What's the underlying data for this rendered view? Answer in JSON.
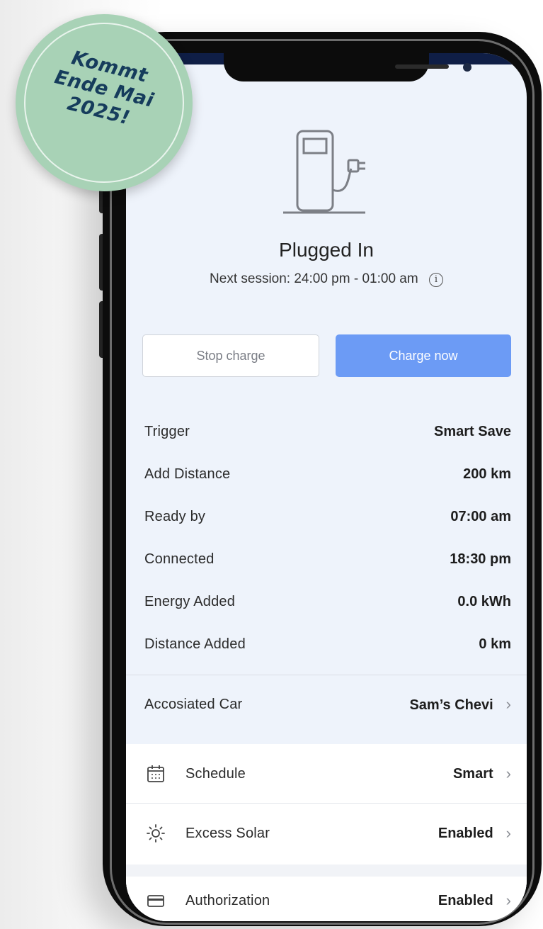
{
  "badge": {
    "lines": [
      "Kommt",
      "Ende Mai",
      "2025!"
    ]
  },
  "status": {
    "title": "Plugged In",
    "next_session": "Next session: 24:00 pm - 01:00 am",
    "info_glyph": "i"
  },
  "buttons": {
    "stop": "Stop charge",
    "charge": "Charge now"
  },
  "details": [
    {
      "label": "Trigger",
      "value": "Smart Save"
    },
    {
      "label": "Add Distance",
      "value": "200 km"
    },
    {
      "label": "Ready by",
      "value": "07:00 am"
    },
    {
      "label": "Connected",
      "value": "18:30 pm"
    },
    {
      "label": "Energy Added",
      "value": "0.0 kWh"
    },
    {
      "label": "Distance Added",
      "value": "0 km"
    }
  ],
  "associated_car": {
    "label": "Accosiated Car",
    "value": "Sam’s Chevi"
  },
  "settings": [
    {
      "icon": "calendar-icon",
      "label": "Schedule",
      "value": "Smart"
    },
    {
      "icon": "sun-icon",
      "label": "Excess Solar",
      "value": "Enabled"
    },
    {
      "icon": "card-icon",
      "label": "Authorization",
      "value": "Enabled"
    }
  ],
  "colors": {
    "accent": "#6c9bf5",
    "screen_bg": "#eef3fb",
    "badge_bg": "#a8d2b6",
    "badge_text": "#163c5c"
  }
}
